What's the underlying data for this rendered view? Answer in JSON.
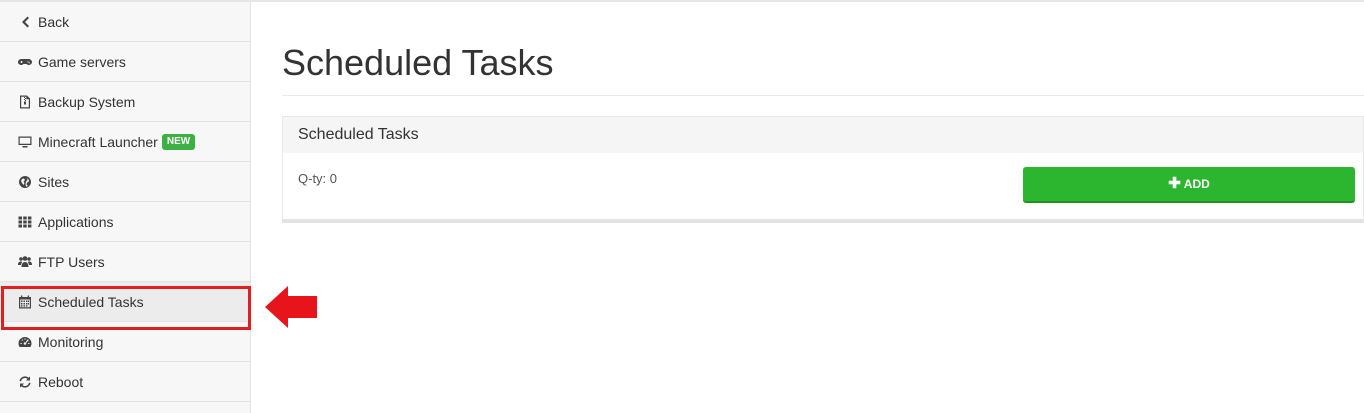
{
  "sidebar": {
    "items": [
      {
        "label": "Back",
        "icon": "chevron-left-icon"
      },
      {
        "label": "Game servers",
        "icon": "gamepad-icon"
      },
      {
        "label": "Backup System",
        "icon": "archive-file-icon"
      },
      {
        "label": "Minecraft Launcher",
        "icon": "monitor-icon",
        "badge": "NEW"
      },
      {
        "label": "Sites",
        "icon": "globe-icon"
      },
      {
        "label": "Applications",
        "icon": "grid-icon"
      },
      {
        "label": "FTP Users",
        "icon": "users-icon"
      },
      {
        "label": "Scheduled Tasks",
        "icon": "calendar-icon"
      },
      {
        "label": "Monitoring",
        "icon": "dashboard-icon"
      },
      {
        "label": "Reboot",
        "icon": "refresh-icon"
      }
    ]
  },
  "main": {
    "title": "Scheduled Tasks",
    "panel": {
      "heading": "Scheduled Tasks",
      "qty": "Q-ty: 0",
      "add_label": "ADD",
      "add_icon": "plus-icon"
    }
  },
  "annotation": {
    "highlight_color": "#e02020",
    "arrow_icon": "arrow-left-icon"
  },
  "colors": {
    "accent_green": "#2cb52f",
    "badge_green": "#3cb043"
  }
}
